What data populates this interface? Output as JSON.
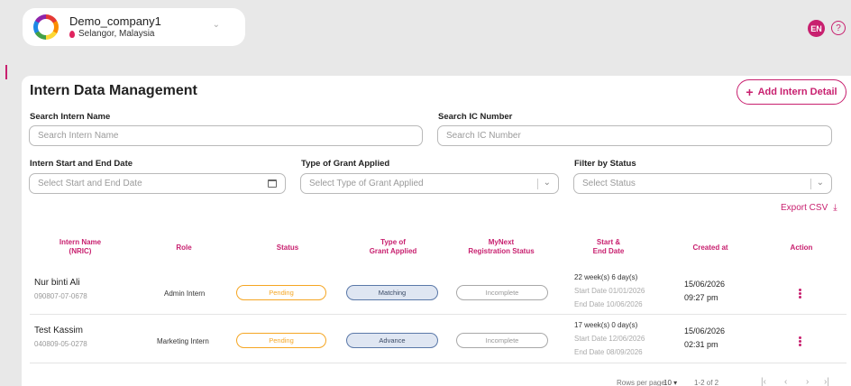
{
  "company": {
    "name": "Demo_company1",
    "location": "Selangor, Malaysia"
  },
  "header": {
    "language": "EN",
    "help": "?"
  },
  "page": {
    "title": "Intern Data Management",
    "add_button": "+ Add Intern Detail",
    "add_label": "Add Intern Detail"
  },
  "filters": {
    "search_name_label": "Search Intern Name",
    "search_name_placeholder": "Search Intern Name",
    "search_ic_label": "Search IC Number",
    "search_ic_placeholder": "Search IC Number",
    "date_label": "Intern Start and End Date",
    "date_placeholder": "Select Start and End Date",
    "grant_label": "Type of Grant Applied",
    "grant_placeholder": "Select Type of Grant Applied",
    "status_label": "Filter by Status",
    "status_placeholder": "Select Status"
  },
  "export": {
    "label": "Export CSV"
  },
  "table": {
    "headers": {
      "name": "Intern Name",
      "name_sub": "(NRIC)",
      "role": "Role",
      "status": "Status",
      "grant": "Type of",
      "grant_sub": "Grant Applied",
      "reg": "MyNext",
      "reg_sub": "Registration Status",
      "dates": "Start &",
      "dates_sub": "End Date",
      "created": "Created at",
      "action": "Action"
    },
    "rows": [
      {
        "name": "Nur binti Ali",
        "nric": "090807-07-0678",
        "role": "Admin Intern",
        "status": "Pending",
        "grant": "Matching",
        "registration": "Incomplete",
        "duration": "22 week(s) 6 day(s)",
        "start": "Start Date 01/01/2026",
        "end": "End Date 10/06/2026",
        "created_date": "15/06/2026",
        "created_time": "09:27 pm"
      },
      {
        "name": "Test Kassim",
        "nric": "040809-05-0278",
        "role": "Marketing Intern",
        "status": "Pending",
        "grant": "Advance",
        "registration": "Incomplete",
        "duration": "17 week(s) 0 day(s)",
        "start": "Start Date 12/06/2026",
        "end": "End Date 08/09/2026",
        "created_date": "15/06/2026",
        "created_time": "02:31 pm"
      }
    ]
  },
  "pagination": {
    "rows_per_page_label": "Rows per page",
    "rows_per_page": "10",
    "range": "1-2 of 2"
  },
  "colors": {
    "accent": "#c8206f",
    "pending": "#f5a623",
    "grant_fill": "#dfe6f2",
    "background": "#e8e8e8"
  }
}
